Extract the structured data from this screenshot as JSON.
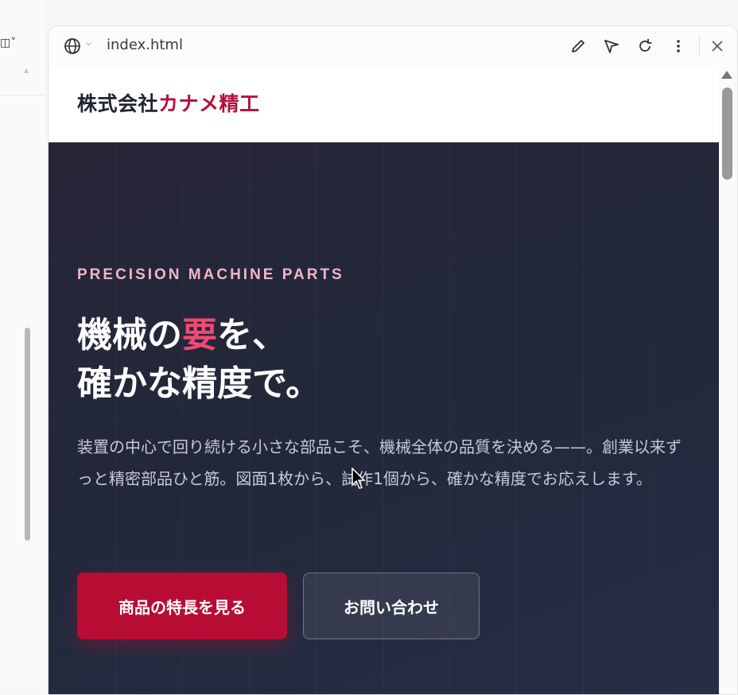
{
  "browser": {
    "url": "index.html",
    "icons": [
      "globe-icon",
      "chevron-down-icon",
      "pencil-icon",
      "send-icon",
      "refresh-icon",
      "more-vertical-icon",
      "close-icon"
    ]
  },
  "site": {
    "logo_main": "株式会社",
    "logo_accent": "カナメ精工"
  },
  "hero": {
    "eyebrow": "PRECISION MACHINE PARTS",
    "headline_part1": "機械の",
    "headline_highlight": "要",
    "headline_part2": "を、",
    "headline_line2": "確かな精度で。",
    "lead": "装置の中心で回り続ける小さな部品こそ、機械全体の品質を決める——。創業以来ずっと精密部品ひと筋。図面1枚から、試作1個から、確かな精度でお応えします。",
    "primary_button": "商品の特長を見る",
    "secondary_button": "お問い合わせ"
  },
  "colors": {
    "accent": "#b5103a",
    "highlight": "#ef4a72",
    "eyebrow": "#f3b5c8",
    "hero_bg": "#22283a"
  }
}
